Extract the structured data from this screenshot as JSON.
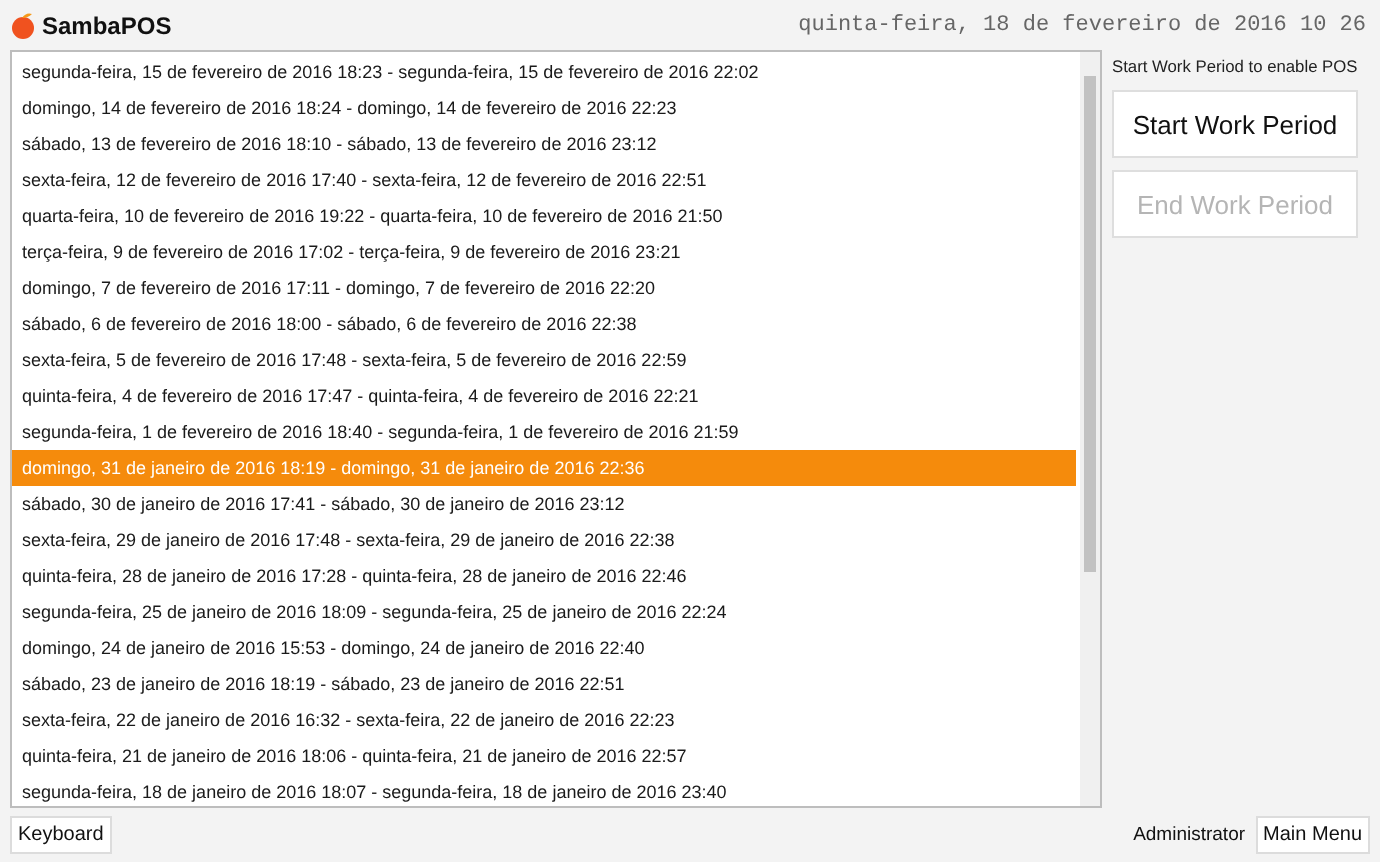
{
  "header": {
    "logo": "SambaPOS",
    "datetime": "quinta-feira, 18 de fevereiro de 2016 10 26"
  },
  "periods": [
    {
      "text": "segunda-feira, 15 de fevereiro de 2016 18:23 - segunda-feira, 15 de fevereiro de 2016 22:02",
      "selected": false
    },
    {
      "text": "domingo, 14 de fevereiro de 2016 18:24 - domingo, 14 de fevereiro de 2016 22:23",
      "selected": false
    },
    {
      "text": "sábado, 13 de fevereiro de 2016 18:10 - sábado, 13 de fevereiro de 2016 23:12",
      "selected": false
    },
    {
      "text": "sexta-feira, 12 de fevereiro de 2016 17:40 - sexta-feira, 12 de fevereiro de 2016 22:51",
      "selected": false
    },
    {
      "text": "quarta-feira, 10 de fevereiro de 2016 19:22 - quarta-feira, 10 de fevereiro de 2016 21:50",
      "selected": false
    },
    {
      "text": "terça-feira, 9 de fevereiro de 2016 17:02 - terça-feira, 9 de fevereiro de 2016 23:21",
      "selected": false
    },
    {
      "text": "domingo, 7 de fevereiro de 2016 17:11 - domingo, 7 de fevereiro de 2016 22:20",
      "selected": false
    },
    {
      "text": "sábado, 6 de fevereiro de 2016 18:00 - sábado, 6 de fevereiro de 2016 22:38",
      "selected": false
    },
    {
      "text": "sexta-feira, 5 de fevereiro de 2016 17:48 - sexta-feira, 5 de fevereiro de 2016 22:59",
      "selected": false
    },
    {
      "text": "quinta-feira, 4 de fevereiro de 2016 17:47 - quinta-feira, 4 de fevereiro de 2016 22:21",
      "selected": false
    },
    {
      "text": "segunda-feira, 1 de fevereiro de 2016 18:40 - segunda-feira, 1 de fevereiro de 2016 21:59",
      "selected": false
    },
    {
      "text": "domingo, 31 de janeiro de 2016 18:19 - domingo, 31 de janeiro de 2016 22:36",
      "selected": true
    },
    {
      "text": "sábado, 30 de janeiro de 2016 17:41 - sábado, 30 de janeiro de 2016 23:12",
      "selected": false
    },
    {
      "text": "sexta-feira, 29 de janeiro de 2016 17:48 - sexta-feira, 29 de janeiro de 2016 22:38",
      "selected": false
    },
    {
      "text": "quinta-feira, 28 de janeiro de 2016 17:28 - quinta-feira, 28 de janeiro de 2016 22:46",
      "selected": false
    },
    {
      "text": "segunda-feira, 25 de janeiro de 2016 18:09 - segunda-feira, 25 de janeiro de 2016 22:24",
      "selected": false
    },
    {
      "text": "domingo, 24 de janeiro de 2016 15:53 - domingo, 24 de janeiro de 2016 22:40",
      "selected": false
    },
    {
      "text": "sábado, 23 de janeiro de 2016 18:19 - sábado, 23 de janeiro de 2016 22:51",
      "selected": false
    },
    {
      "text": "sexta-feira, 22 de janeiro de 2016 16:32 - sexta-feira, 22 de janeiro de 2016 22:23",
      "selected": false
    },
    {
      "text": "quinta-feira, 21 de janeiro de 2016 18:06 - quinta-feira, 21 de janeiro de 2016 22:57",
      "selected": false
    },
    {
      "text": "segunda-feira, 18 de janeiro de 2016 18:07 - segunda-feira, 18 de janeiro de 2016 23:40",
      "selected": false
    }
  ],
  "side": {
    "hint": "Start Work Period to enable POS",
    "buttons": [
      {
        "label": "Start Work Period",
        "disabled": false
      },
      {
        "label": "End Work Period",
        "disabled": true
      }
    ]
  },
  "footer": {
    "keyboard": "Keyboard",
    "user": "Administrator",
    "menu": "Main Menu"
  }
}
